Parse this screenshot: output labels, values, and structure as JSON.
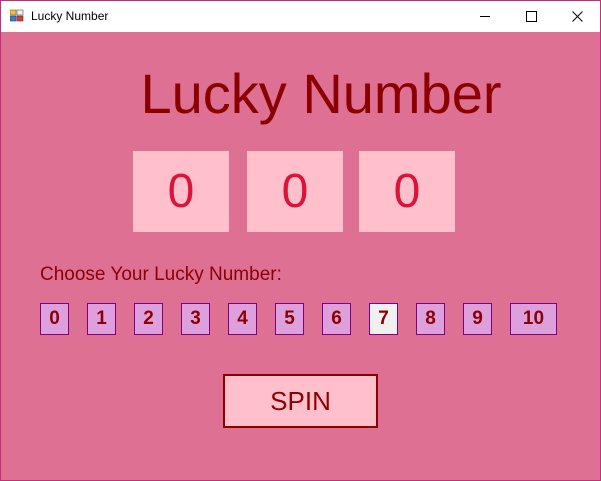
{
  "window": {
    "title": "Lucky Number",
    "controls": {
      "minimize": "minimize-icon",
      "maximize": "maximize-icon",
      "close": "close-icon"
    }
  },
  "main": {
    "heading": "Lucky Number",
    "reels": [
      "0",
      "0",
      "0"
    ],
    "choose_label": "Choose Your Lucky Number:",
    "numbers": [
      "0",
      "1",
      "2",
      "3",
      "4",
      "5",
      "6",
      "7",
      "8",
      "9",
      "10"
    ],
    "selected_number": "7",
    "spin_label": "SPIN"
  },
  "colors": {
    "background": "#dd7093",
    "heading": "#8b0000",
    "reel_bg": "#ffc0cb",
    "reel_text": "#dc143c",
    "number_button_bg": "#dda0dd",
    "number_button_border": "#800080",
    "selected_button_bg": "#f0f0f0"
  }
}
